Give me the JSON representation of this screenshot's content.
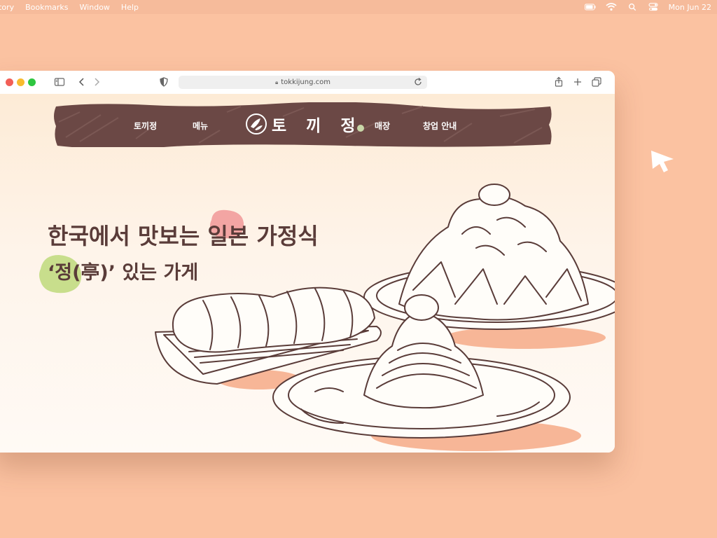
{
  "menubar": {
    "items": [
      "tory",
      "Bookmarks",
      "Window",
      "Help"
    ],
    "datetime": "Mon Jun 22",
    "icons": [
      "battery-icon",
      "wifi-icon",
      "spotlight-search-icon",
      "control-center-icon"
    ]
  },
  "browser": {
    "url": "tokkijung.com"
  },
  "site": {
    "nav": {
      "items": [
        "토끼정",
        "메뉴",
        "매장",
        "창업 안내"
      ],
      "logo_text": "토 끼 정"
    },
    "hero": {
      "line1": "한국에서 맛보는 일본 가정식",
      "line2": "‘정(亭)’ 있는 가게"
    }
  },
  "colors": {
    "background": "#fbc2a1",
    "nav_brown": "#6b4845",
    "text_brown": "#5a3c39",
    "highlight_pink": "#f3a5a3",
    "highlight_green": "#c8de8c",
    "plate_shadow": "#f7b697"
  }
}
